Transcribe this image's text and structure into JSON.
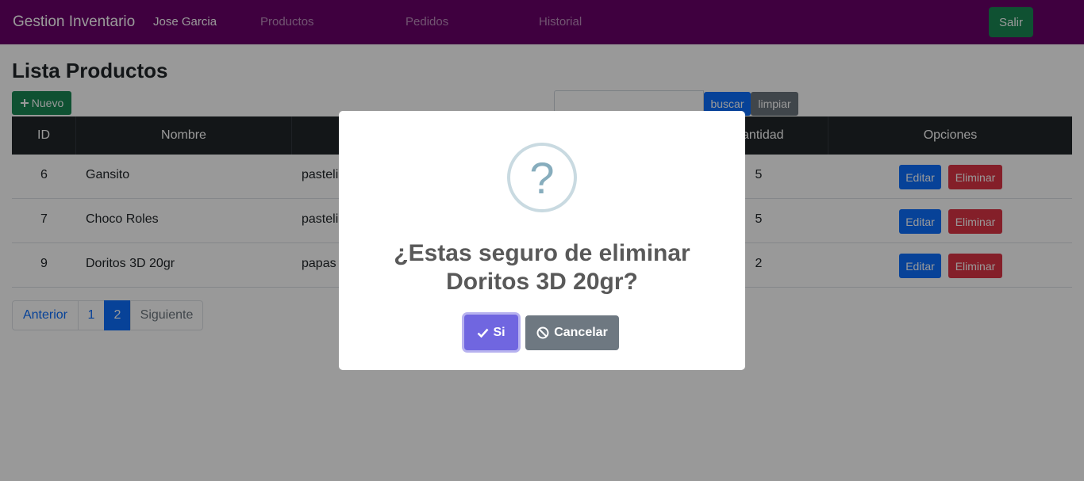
{
  "navbar": {
    "brand": "Gestion Inventario",
    "user": "Jose Garcia",
    "links": [
      "Productos",
      "Pedidos",
      "Historial"
    ],
    "logout": "Salir",
    "color": "#6a006a"
  },
  "page": {
    "title": "Lista Productos",
    "new_button": "Nuevo",
    "search": {
      "value": "",
      "button": "buscar",
      "clear": "limpiar"
    }
  },
  "table": {
    "headers": [
      "ID",
      "Nombre",
      "",
      "Cantidad",
      "Opciones"
    ],
    "rows": [
      {
        "id": "6",
        "nombre": "Gansito",
        "desc": "pasteli",
        "cantidad": "5",
        "edit": "Editar",
        "delete": "Eliminar"
      },
      {
        "id": "7",
        "nombre": "Choco Roles",
        "desc": "pasteli",
        "cantidad": "5",
        "edit": "Editar",
        "delete": "Eliminar"
      },
      {
        "id": "9",
        "nombre": "Doritos 3D 20gr",
        "desc": "papas",
        "cantidad": "2",
        "edit": "Editar",
        "delete": "Eliminar"
      }
    ]
  },
  "pagination": {
    "prev": "Anterior",
    "pages": [
      "1",
      "2"
    ],
    "active": "2",
    "next": "Siguiente"
  },
  "modal": {
    "icon": "?",
    "title": "¿Estas seguro de eliminar Doritos 3D 20gr?",
    "confirm": "Si",
    "cancel": "Cancelar"
  }
}
